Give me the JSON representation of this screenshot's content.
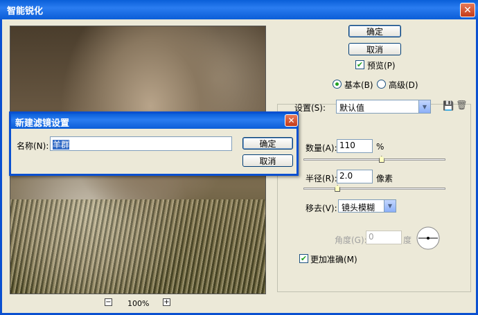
{
  "window": {
    "title": "智能锐化"
  },
  "buttons": {
    "ok": "确定",
    "cancel": "取消"
  },
  "preview_checkbox": {
    "label": "预览(P)",
    "checked": true
  },
  "mode": {
    "basic": "基本(B)",
    "advanced": "高级(D)",
    "selected": "basic"
  },
  "settings": {
    "label": "设置(S):",
    "value": "默认值"
  },
  "amount": {
    "label": "数量(A):",
    "value": "110",
    "unit": "%",
    "fraction": 0.55
  },
  "radius": {
    "label": "半径(R):",
    "value": "2.0",
    "unit": "像素",
    "fraction": 0.24
  },
  "remove": {
    "label": "移去(V):",
    "value": "镜头模糊"
  },
  "angle": {
    "label": "角度(G):",
    "value": "0",
    "unit": "度"
  },
  "more_accurate": {
    "label": "更加准确(M)",
    "checked": true
  },
  "zoom": {
    "level": "100%"
  },
  "dialog": {
    "title": "新建滤镜设置",
    "name_label": "名称(N):",
    "name_value": "羊群",
    "ok": "确定",
    "cancel": "取消"
  },
  "colors": {
    "title_blue": "#0a5fd8",
    "check_green": "#21a121",
    "face": "#ece9d8"
  },
  "icons": [
    "close-icon",
    "save-settings-icon",
    "delete-settings-icon",
    "zoom-out-icon",
    "zoom-in-icon",
    "angle-dial-icon"
  ]
}
